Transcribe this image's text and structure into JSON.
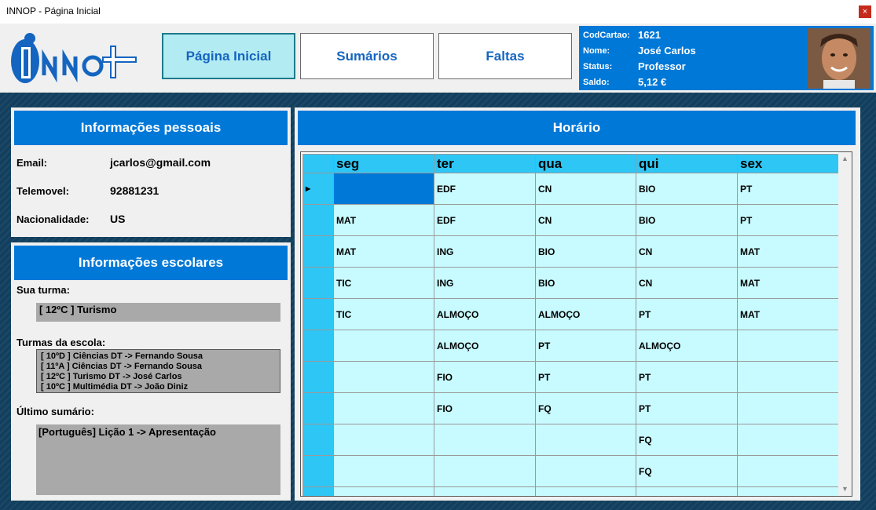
{
  "window": {
    "title": "INNOP - Página Inicial",
    "close_icon": "×"
  },
  "nav": {
    "home": "Página Inicial",
    "sumarios": "Sumários",
    "faltas": "Faltas"
  },
  "user": {
    "cod_label": "CodCartao:",
    "cod_value": "1621",
    "nome_label": "Nome:",
    "nome_value": "José Carlos",
    "status_label": "Status:",
    "status_value": "Professor",
    "saldo_label": "Saldo:",
    "saldo_value": "5,12 €"
  },
  "pessoais": {
    "title": "Informações pessoais",
    "email_label": "Email:",
    "email_value": "jcarlos@gmail.com",
    "tel_label": "Telemovel:",
    "tel_value": "92881231",
    "nac_label": "Nacionalidade:",
    "nac_value": "US"
  },
  "escolares": {
    "title": "Informações escolares",
    "turma_label": "Sua turma:",
    "turma_value": "[ 12ºC ] Turismo",
    "turmas_label": "Turmas da escola:",
    "turmas": [
      "[ 10ºD ] Ciências DT -> Fernando Sousa",
      "[ 11ºA ] Ciências DT -> Fernando Sousa",
      "[ 12ºC ] Turismo DT -> José Carlos",
      "[ 10ºC ] Multimédia DT -> João Diniz"
    ],
    "sumario_label": "Último sumário:",
    "sumario_value": "[Português] Lição 1 -> Apresentação"
  },
  "horario": {
    "title": "Horário",
    "days": [
      "seg",
      "ter",
      "qua",
      "qui",
      "sex"
    ],
    "rows": [
      [
        "",
        "EDF",
        "CN",
        "BIO",
        "PT"
      ],
      [
        "MAT",
        "EDF",
        "CN",
        "BIO",
        "PT"
      ],
      [
        "MAT",
        "ING",
        "BIO",
        "CN",
        "MAT"
      ],
      [
        "TIC",
        "ING",
        "BIO",
        "CN",
        "MAT"
      ],
      [
        "TIC",
        "ALMOÇO",
        "ALMOÇO",
        "PT",
        "MAT"
      ],
      [
        "",
        "ALMOÇO",
        "PT",
        "ALMOÇO",
        ""
      ],
      [
        "",
        "FIO",
        "PT",
        "PT",
        ""
      ],
      [
        "",
        "FIO",
        "FQ",
        "PT",
        ""
      ],
      [
        "",
        "",
        "",
        "FQ",
        ""
      ],
      [
        "",
        "",
        "",
        "FQ",
        ""
      ],
      [
        "",
        "",
        "",
        "",
        ""
      ]
    ]
  },
  "colors": {
    "accent": "#0078d7",
    "header_cell": "#2ec6f5",
    "cell": "#c8fbff"
  }
}
